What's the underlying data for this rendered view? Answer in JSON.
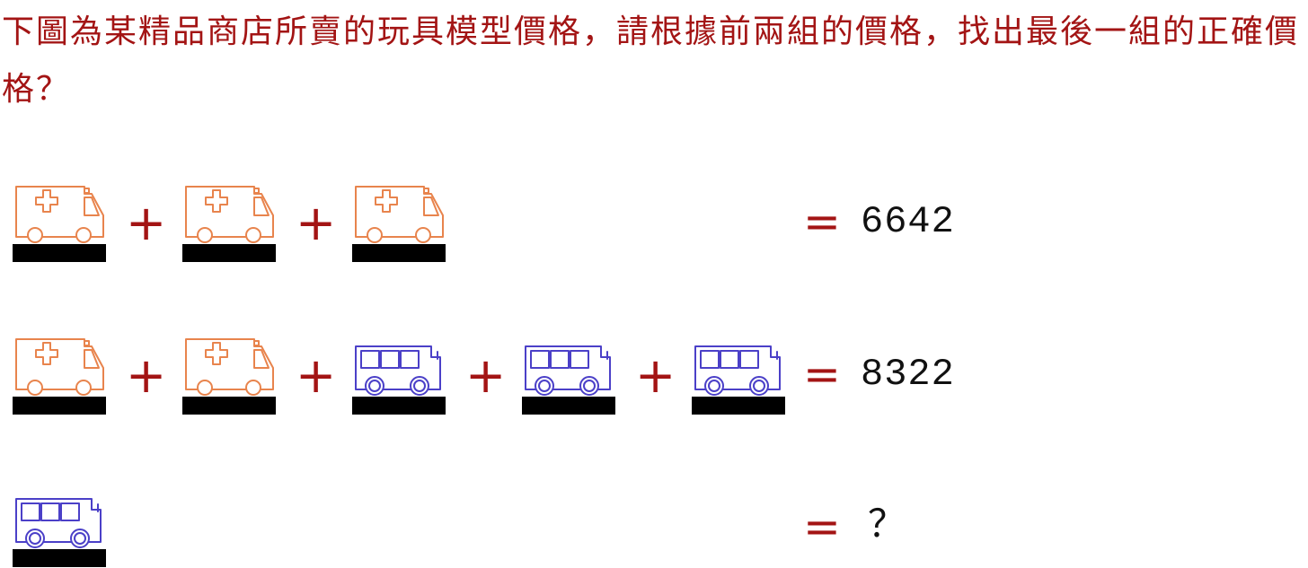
{
  "question": "下圖為某精品商店所賣的玩具模型價格，請根據前兩組的價格，找出最後一組的正確價格？",
  "rows": [
    {
      "items": [
        "ambulance",
        "ambulance",
        "ambulance"
      ],
      "operators": [
        "+",
        "+"
      ],
      "equals": "=",
      "result": "6642"
    },
    {
      "items": [
        "ambulance",
        "ambulance",
        "bus",
        "bus",
        "bus"
      ],
      "operators": [
        "+",
        "+",
        "+",
        "+"
      ],
      "equals": "=",
      "result": "8322"
    },
    {
      "items": [
        "bus"
      ],
      "operators": [],
      "equals": "=",
      "result": "？"
    }
  ],
  "colors": {
    "question_text": "#a31414",
    "operator": "#a31414",
    "ambulance_icon": "#e8844d",
    "bus_icon": "#4b40c8",
    "base_bar": "#000000",
    "result_text": "#111111"
  }
}
